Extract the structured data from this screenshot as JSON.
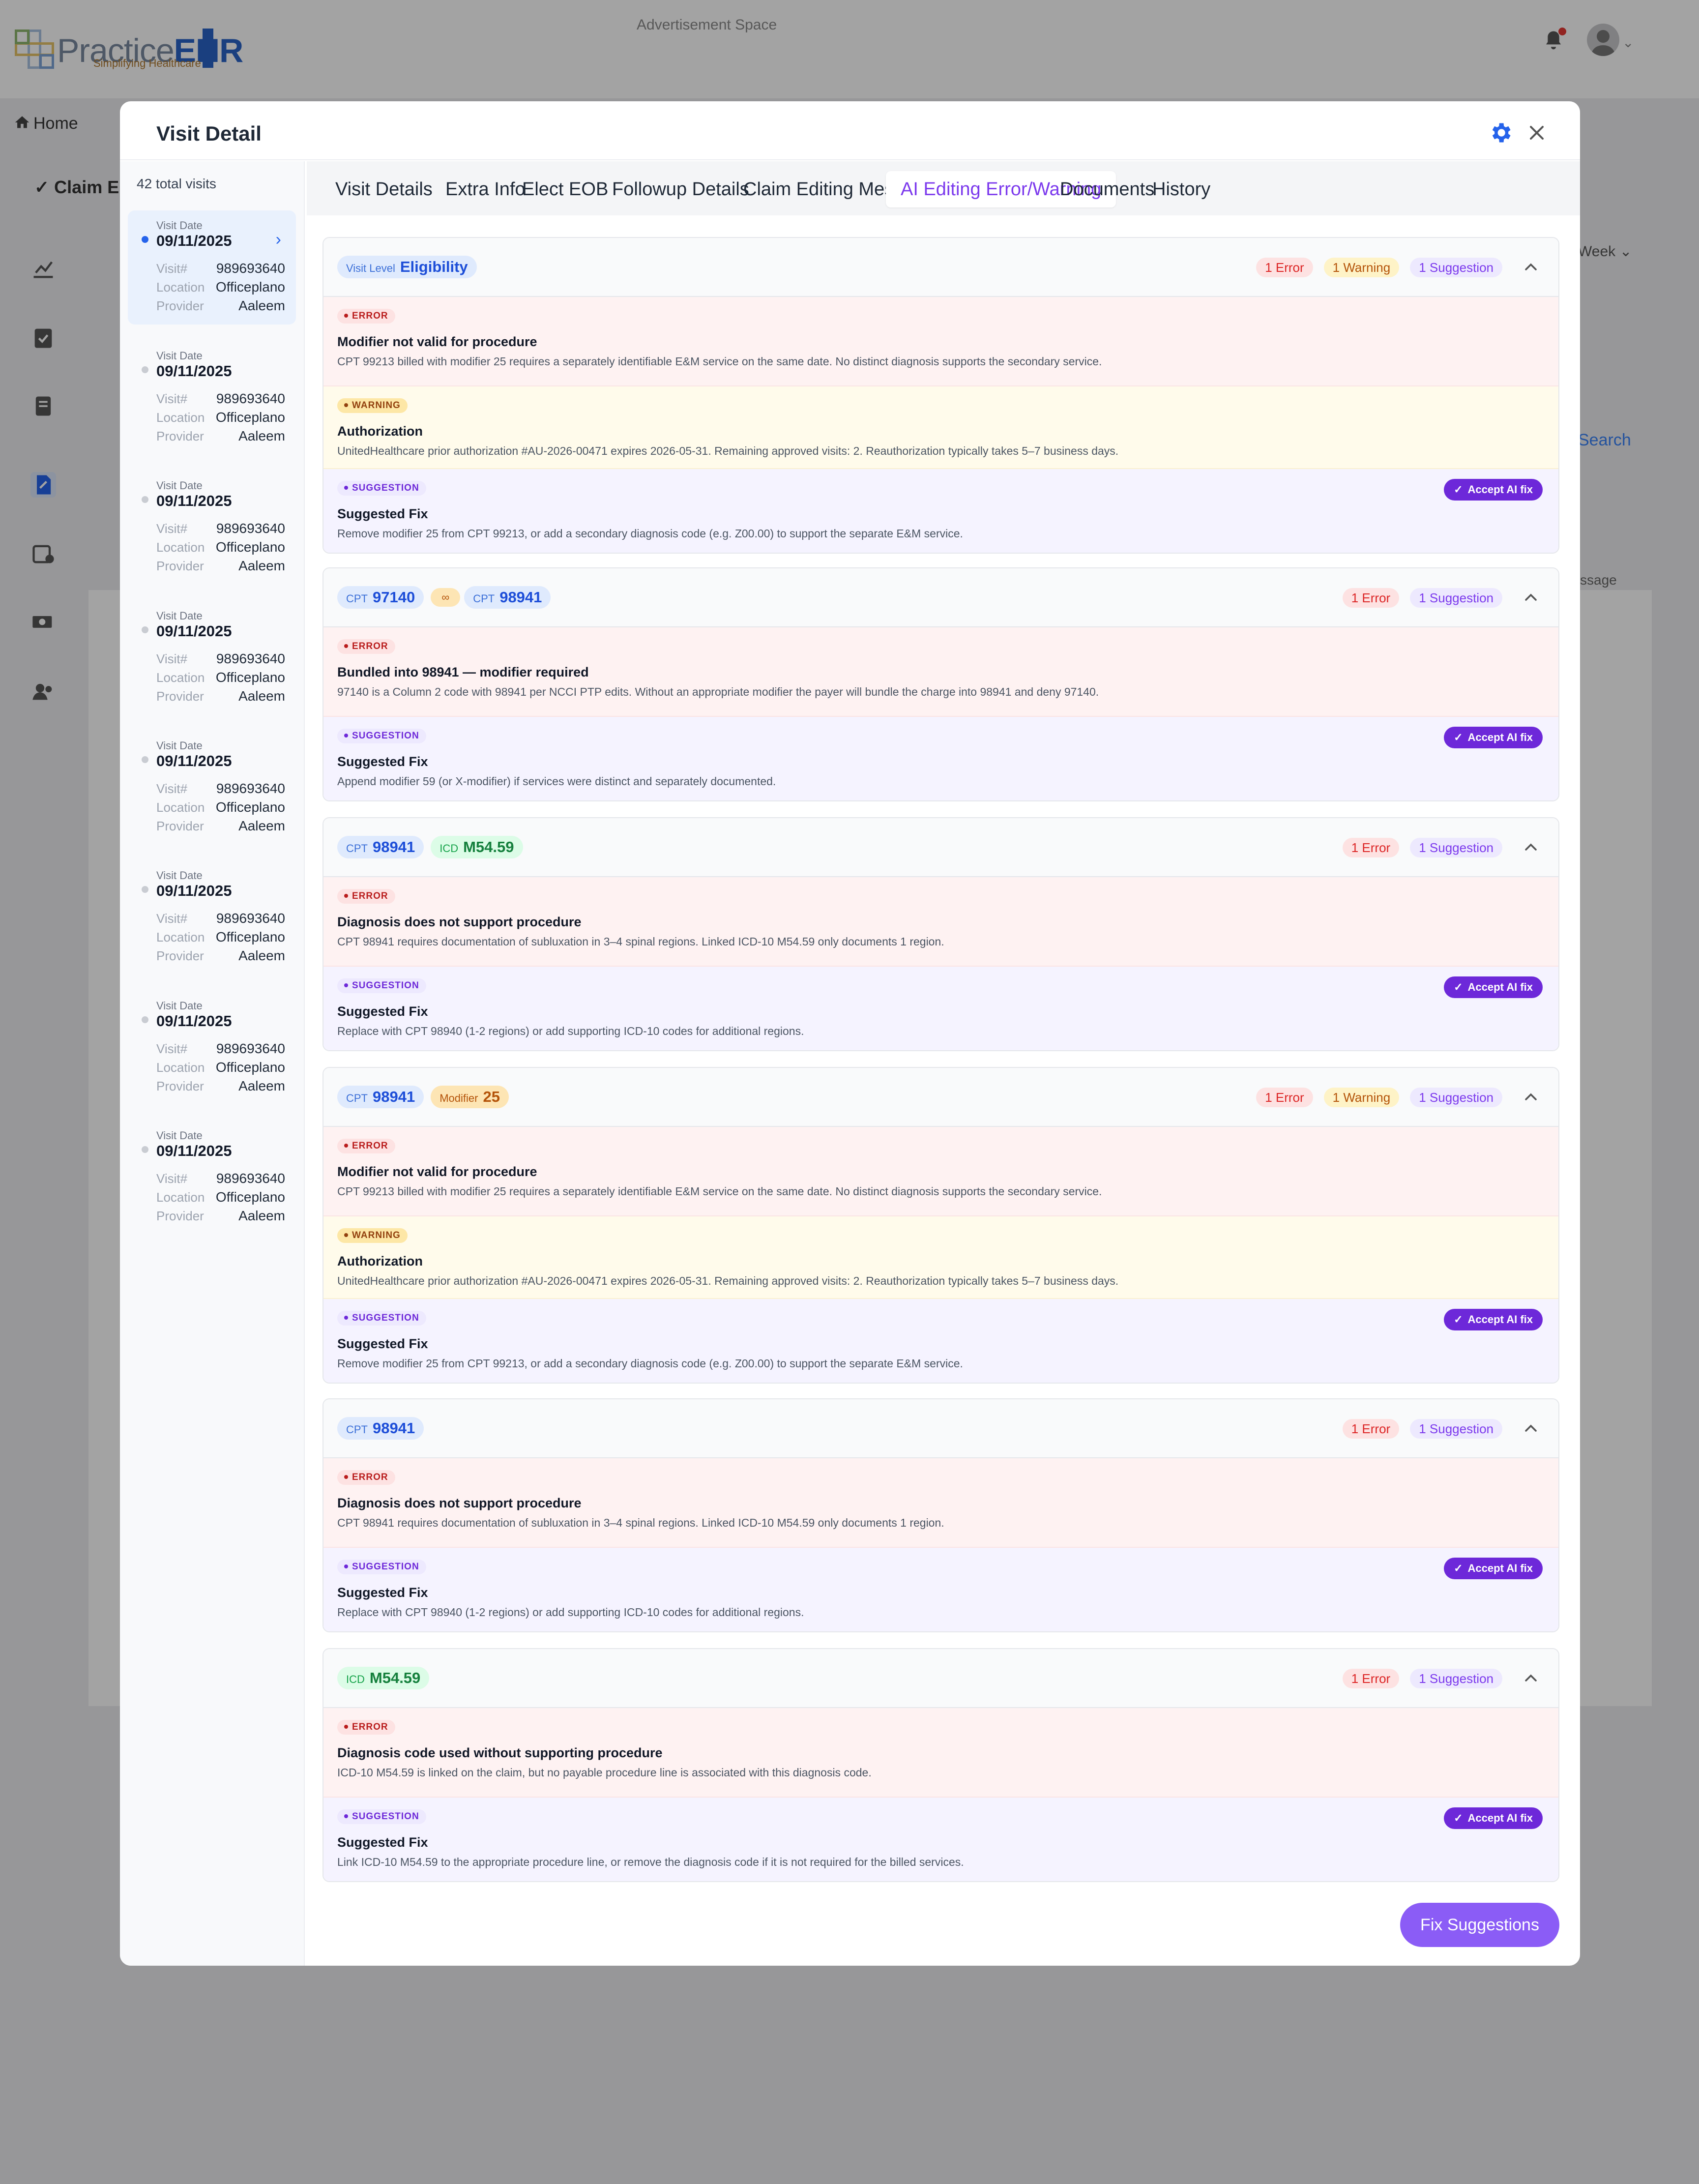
{
  "app": {
    "logo_primary": "Practice",
    "logo_accent": "EHR",
    "logo_tagline": "Simplifying Healthcare",
    "ad_text": "Advertisement Space",
    "home_label": "Home",
    "claim_edit_label": "Claim E",
    "bg_week": "Week",
    "bg_search": "Search",
    "bg_message": "ssage"
  },
  "modal": {
    "title": "Visit Detail",
    "icons": {
      "settings": "gear-icon",
      "close": "close-icon"
    }
  },
  "visits": {
    "total": "42 total visits",
    "date_label": "Visit Date",
    "visit_label": "Visit#",
    "location_label": "Location",
    "provider_label": "Provider",
    "items": [
      {
        "date": "09/11/2025",
        "visit_no": "989693640",
        "location": "Officeplano",
        "provider": "Aaleem"
      },
      {
        "date": "09/11/2025",
        "visit_no": "989693640",
        "location": "Officeplano",
        "provider": "Aaleem"
      },
      {
        "date": "09/11/2025",
        "visit_no": "989693640",
        "location": "Officeplano",
        "provider": "Aaleem"
      },
      {
        "date": "09/11/2025",
        "visit_no": "989693640",
        "location": "Officeplano",
        "provider": "Aaleem"
      },
      {
        "date": "09/11/2025",
        "visit_no": "989693640",
        "location": "Officeplano",
        "provider": "Aaleem"
      },
      {
        "date": "09/11/2025",
        "visit_no": "989693640",
        "location": "Officeplano",
        "provider": "Aaleem"
      },
      {
        "date": "09/11/2025",
        "visit_no": "989693640",
        "location": "Officeplano",
        "provider": "Aaleem"
      },
      {
        "date": "09/11/2025",
        "visit_no": "989693640",
        "location": "Officeplano",
        "provider": "Aaleem"
      }
    ]
  },
  "tabs": [
    "Visit Details",
    "Extra Info",
    "Elect EOB",
    "Followup Details",
    "Claim Editing Message",
    "AI Editing Error/Warning",
    "Documents",
    "History"
  ],
  "active_tab": "AI Editing Error/Warning",
  "labels": {
    "error": "ERROR",
    "warning": "WARNING",
    "suggestion": "SUGGESTION",
    "accept": "Accept AI fix",
    "count_error": "1 Error",
    "count_warning": "1 Warning",
    "count_suggestion": "1 Suggestion",
    "cpt": "CPT",
    "icd": "ICD",
    "modifier": "Modifier",
    "visit_level": "Visit Level"
  },
  "cards": [
    {
      "tags": [
        {
          "key": "Visit Level",
          "value": "Eligibility"
        }
      ],
      "counts": [
        "1 Error",
        "1 Warning",
        "1 Suggestion"
      ],
      "sections": [
        {
          "type": "error",
          "title": "Modifier not valid for procedure",
          "desc": "CPT 99213 billed with modifier 25 requires a separately identifiable E&M service on the same date. No distinct diagnosis supports the secondary service."
        },
        {
          "type": "warning",
          "title": "Authorization",
          "desc": "UnitedHealthcare prior authorization #AU-2026-00471 expires 2026-05-31. Remaining approved visits: 2. Reauthorization typically takes 5–7 business days."
        },
        {
          "type": "suggestion",
          "title": "Suggested Fix",
          "desc": "Remove modifier 25 from CPT 99213, or add a secondary diagnosis code (e.g. Z00.00) to support the separate E&M service."
        }
      ]
    },
    {
      "tags": [
        {
          "key": "CPT",
          "value": "97140"
        },
        {
          "key": "CPT",
          "value": "98941"
        }
      ],
      "link_icon": "link-icon",
      "counts": [
        "1 Error",
        "1 Suggestion"
      ],
      "sections": [
        {
          "type": "error",
          "title": "Bundled into 98941 — modifier required",
          "desc": "97140 is a Column 2 code with 98941 per NCCI PTP edits. Without an appropriate modifier the payer will bundle the charge into 98941 and deny 97140."
        },
        {
          "type": "suggestion",
          "title": "Suggested Fix",
          "desc": "Append modifier 59 (or X-modifier) if services were distinct and separately documented."
        }
      ]
    },
    {
      "tags": [
        {
          "key": "CPT",
          "value": "98941"
        },
        {
          "key": "ICD",
          "value": "M54.59"
        }
      ],
      "counts": [
        "1 Error",
        "1 Suggestion"
      ],
      "sections": [
        {
          "type": "error",
          "title": "Diagnosis does not support procedure",
          "desc": "CPT 98941 requires documentation of subluxation in 3–4 spinal regions. Linked ICD-10 M54.59 only documents 1 region."
        },
        {
          "type": "suggestion",
          "title": "Suggested Fix",
          "desc": "Replace with CPT 98940 (1-2 regions) or add supporting ICD-10 codes for additional regions."
        }
      ]
    },
    {
      "tags": [
        {
          "key": "CPT",
          "value": "98941"
        },
        {
          "key": "Modifier",
          "value": "25"
        }
      ],
      "counts": [
        "1 Error",
        "1 Warning",
        "1 Suggestion"
      ],
      "sections": [
        {
          "type": "error",
          "title": "Modifier not valid for procedure",
          "desc": "CPT 99213 billed with modifier 25 requires a separately identifiable E&M service on the same date. No distinct diagnosis supports the secondary service."
        },
        {
          "type": "warning",
          "title": "Authorization",
          "desc": "UnitedHealthcare prior authorization #AU-2026-00471 expires 2026-05-31. Remaining approved visits: 2. Reauthorization typically takes 5–7 business days."
        },
        {
          "type": "suggestion",
          "title": "Suggested Fix",
          "desc": "Remove modifier 25 from CPT 99213, or add a secondary diagnosis code (e.g. Z00.00) to support the separate E&M service."
        }
      ]
    },
    {
      "tags": [
        {
          "key": "CPT",
          "value": "98941"
        }
      ],
      "counts": [
        "1 Error",
        "1 Suggestion"
      ],
      "sections": [
        {
          "type": "error",
          "title": "Diagnosis does not support procedure",
          "desc": "CPT 98941 requires documentation of subluxation in 3–4 spinal regions. Linked ICD-10 M54.59 only documents 1 region."
        },
        {
          "type": "suggestion",
          "title": "Suggested Fix",
          "desc": "Replace with CPT 98940 (1-2 regions) or add supporting ICD-10 codes for additional regions."
        }
      ]
    },
    {
      "tags": [
        {
          "key": "ICD",
          "value": "M54.59"
        }
      ],
      "counts": [
        "1 Error",
        "1 Suggestion"
      ],
      "sections": [
        {
          "type": "error",
          "title": "Diagnosis code used without supporting procedure",
          "desc": "ICD-10 M54.59 is linked on the claim, but no payable procedure line is associated with this diagnosis code."
        },
        {
          "type": "suggestion",
          "title": "Suggested Fix",
          "desc": "Link ICD-10 M54.59 to the appropriate procedure line, or remove the diagnosis code if it is not required for the billed services."
        }
      ]
    }
  ],
  "fix_button": "Fix Suggestions",
  "colors": {
    "accent": "#7c3aed",
    "primary": "#2563eb",
    "error": "#dc2626",
    "warning": "#b45309"
  }
}
